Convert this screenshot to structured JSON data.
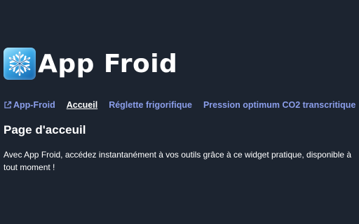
{
  "app": {
    "title": "App Froid",
    "logo_icon": "snowflake-icon"
  },
  "nav": {
    "external_link": "App-Froid",
    "items": [
      {
        "label": "Accueil",
        "active": true
      },
      {
        "label": "Réglette frigorifique",
        "active": false
      },
      {
        "label": "Pression optimum CO2 transcritique",
        "active": false
      }
    ]
  },
  "main": {
    "heading": "Page d'acceuil",
    "description": "Avec App Froid, accédez instantanément à vos outils grâce à ce widget pratique, disponible à tout moment !"
  },
  "colors": {
    "background": "#1c2430",
    "link": "#8b9eea",
    "text": "#ffffff"
  }
}
